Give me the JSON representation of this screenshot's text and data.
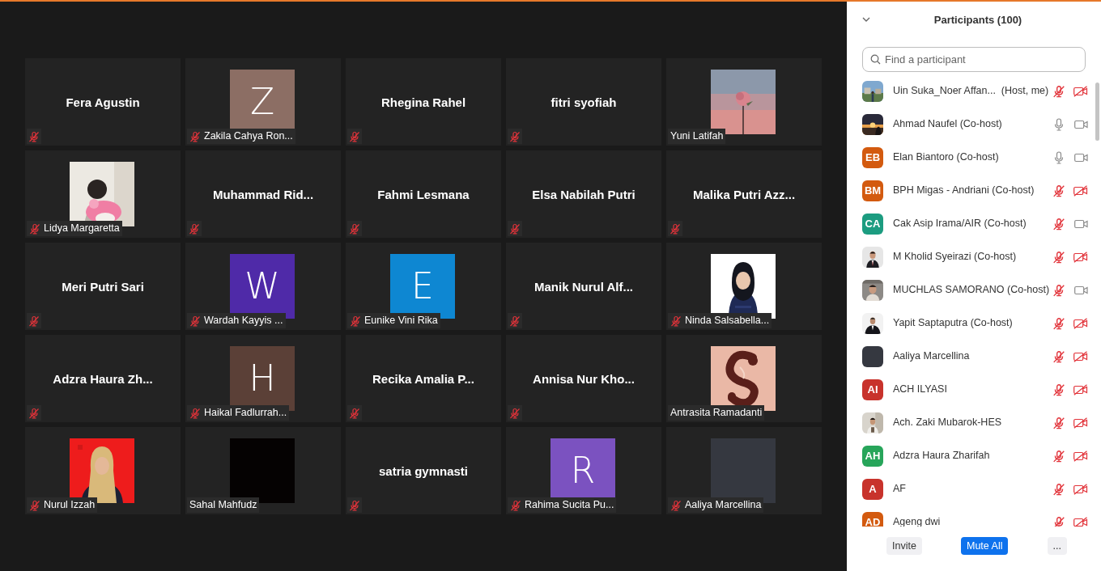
{
  "gallery": {
    "tiles": [
      {
        "kind": "name",
        "name": "Fera Agustin",
        "muted": true
      },
      {
        "kind": "letter",
        "letter": "Z",
        "color": "#8c6e64",
        "name": "Zakila Cahya Ron...",
        "muted": true
      },
      {
        "kind": "name",
        "name": "Rhegina Rahel",
        "muted": true
      },
      {
        "kind": "name",
        "name": "fitri syofiah",
        "muted": true
      },
      {
        "kind": "picture",
        "name": "Yuni Latifah",
        "muted": false
      },
      {
        "kind": "picture",
        "name": "Lidya Margaretta",
        "muted": true
      },
      {
        "kind": "name",
        "name": "Muhammad Rid...",
        "muted": true
      },
      {
        "kind": "name",
        "name": "Fahmi Lesmana",
        "muted": true
      },
      {
        "kind": "name",
        "name": "Elsa Nabilah Putri",
        "muted": true
      },
      {
        "kind": "name",
        "name": "Malika Putri Azz...",
        "muted": true
      },
      {
        "kind": "name",
        "name": "Meri Putri Sari",
        "muted": true
      },
      {
        "kind": "letter",
        "letter": "W",
        "color": "#4f2aa8",
        "name": "Wardah Kayyis ...",
        "muted": true
      },
      {
        "kind": "letter",
        "letter": "E",
        "color": "#0e87d2",
        "name": "Eunike Vini Rika",
        "muted": true
      },
      {
        "kind": "name",
        "name": "Manik Nurul Alf...",
        "muted": true
      },
      {
        "kind": "picture",
        "name": "Ninda Salsabella...",
        "muted": true
      },
      {
        "kind": "name",
        "name": "Adzra Haura Zh...",
        "muted": true
      },
      {
        "kind": "letter",
        "letter": "H",
        "color": "#5b4037",
        "name": "Haikal Fadlurrah...",
        "muted": true
      },
      {
        "kind": "name",
        "name": "Recika Amalia P...",
        "muted": true
      },
      {
        "kind": "name",
        "name": "Annisa Nur Kho...",
        "muted": true
      },
      {
        "kind": "picture",
        "name": "Antrasita Ramadanti",
        "muted": false
      },
      {
        "kind": "picture",
        "name": "Nurul Izzah",
        "muted": true
      },
      {
        "kind": "blank",
        "color": "#050202",
        "name": "Sahal Mahfudz",
        "muted": false
      },
      {
        "kind": "name",
        "name": "satria gymnasti",
        "muted": true
      },
      {
        "kind": "letter",
        "letter": "R",
        "color": "#7b52c0",
        "name": "Rahima Sucita Pu...",
        "muted": true
      },
      {
        "kind": "blank",
        "color": "#353840",
        "name": "Aaliya Marcellina",
        "muted": true
      }
    ]
  },
  "participants": {
    "title": "Participants (100)",
    "search": {
      "placeholder": "Find a participant"
    },
    "items": [
      {
        "kind": "picture",
        "name": "Uin Suka_Noer Affan...  (Host, me)",
        "muted": true,
        "video": false
      },
      {
        "kind": "picture",
        "name": "Ahmad Naufel (Co-host)",
        "muted": false,
        "video": true
      },
      {
        "kind": "initials",
        "initials": "EB",
        "color": "#d35a0f",
        "name": "Elan Biantoro (Co-host)",
        "muted": false,
        "video": true
      },
      {
        "kind": "initials",
        "initials": "BM",
        "color": "#d35a0f",
        "name": "BPH Migas - Andriani (Co-host)",
        "muted": true,
        "video": false
      },
      {
        "kind": "initials",
        "initials": "CA",
        "color": "#1c9c80",
        "name": "Cak Asip Irama/AIR (Co-host)",
        "muted": true,
        "video": true
      },
      {
        "kind": "picture",
        "name": "M Kholid Syeirazi (Co-host)",
        "muted": true,
        "video": false
      },
      {
        "kind": "picture",
        "name": "MUCHLAS SAMORANO (Co-host)",
        "muted": true,
        "video": true
      },
      {
        "kind": "picture",
        "name": "Yapit Saptaputra (Co-host)",
        "muted": true,
        "video": false
      },
      {
        "kind": "blank",
        "color": "#353840",
        "name": "Aaliya Marcellina",
        "muted": true,
        "video": false
      },
      {
        "kind": "initials",
        "initials": "AI",
        "color": "#c8332c",
        "name": "ACH ILYASI",
        "muted": true,
        "video": false
      },
      {
        "kind": "picture",
        "name": "Ach. Zaki Mubarok-HES",
        "muted": true,
        "video": false
      },
      {
        "kind": "initials",
        "initials": "AH",
        "color": "#27a55a",
        "name": "Adzra Haura Zharifah",
        "muted": true,
        "video": false
      },
      {
        "kind": "initials",
        "initials": "A",
        "color": "#c8332c",
        "name": "AF",
        "muted": true,
        "video": false
      },
      {
        "kind": "initials",
        "initials": "AD",
        "color": "#d35a0f",
        "name": "Ageng dwi",
        "muted": true,
        "video": false
      }
    ],
    "buttons": [
      {
        "kind": "plain",
        "label": "Invite"
      },
      {
        "kind": "primary",
        "label": "Mute All"
      },
      {
        "kind": "plain",
        "label": "..."
      }
    ]
  }
}
